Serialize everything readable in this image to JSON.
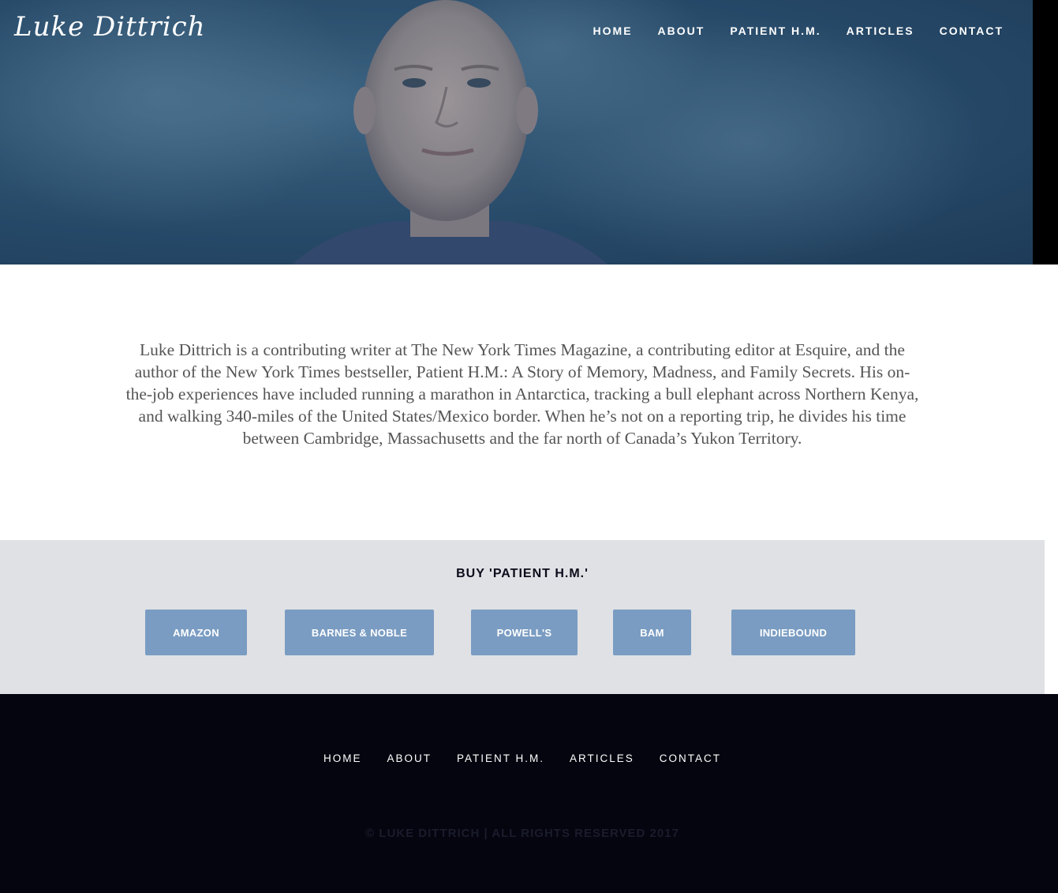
{
  "header": {
    "logo": "Luke Dittrich",
    "nav": [
      "HOME",
      "ABOUT",
      "PATIENT H.M.",
      "ARTICLES",
      "CONTACT"
    ]
  },
  "hero": {
    "image": "portrait-photo"
  },
  "bio": {
    "text": "Luke Dittrich is a contributing writer at The New York Times Magazine, a contributing editor at Esquire, and the author of the New York Times bestseller, Patient H.M.: A Story of Memory, Madness, and Family Secrets. His on-the-job experiences have included running a marathon in Antarctica, tracking a bull elephant across Northern Kenya, and walking 340-miles of the United States/Mexico border. When he’s not on a reporting trip, he divides his time between Cambridge, Massachusetts and the far north of Canada’s Yukon Territory."
  },
  "buy": {
    "heading": "BUY 'PATIENT H.M.'",
    "buttons": [
      "AMAZON",
      "BARNES & NOBLE",
      "POWELL'S",
      "BAM",
      "INDIEBOUND"
    ]
  },
  "footer": {
    "nav": [
      "HOME",
      "ABOUT",
      "PATIENT H.M.",
      "ARTICLES",
      "CONTACT"
    ],
    "copyright": "© LUKE DITTRICH | ALL RIGHTS RESERVED 2017"
  },
  "colors": {
    "button_bg": "#7a9cc2",
    "buy_bg": "#dfe1e5",
    "footer_bg": "#04050f"
  }
}
